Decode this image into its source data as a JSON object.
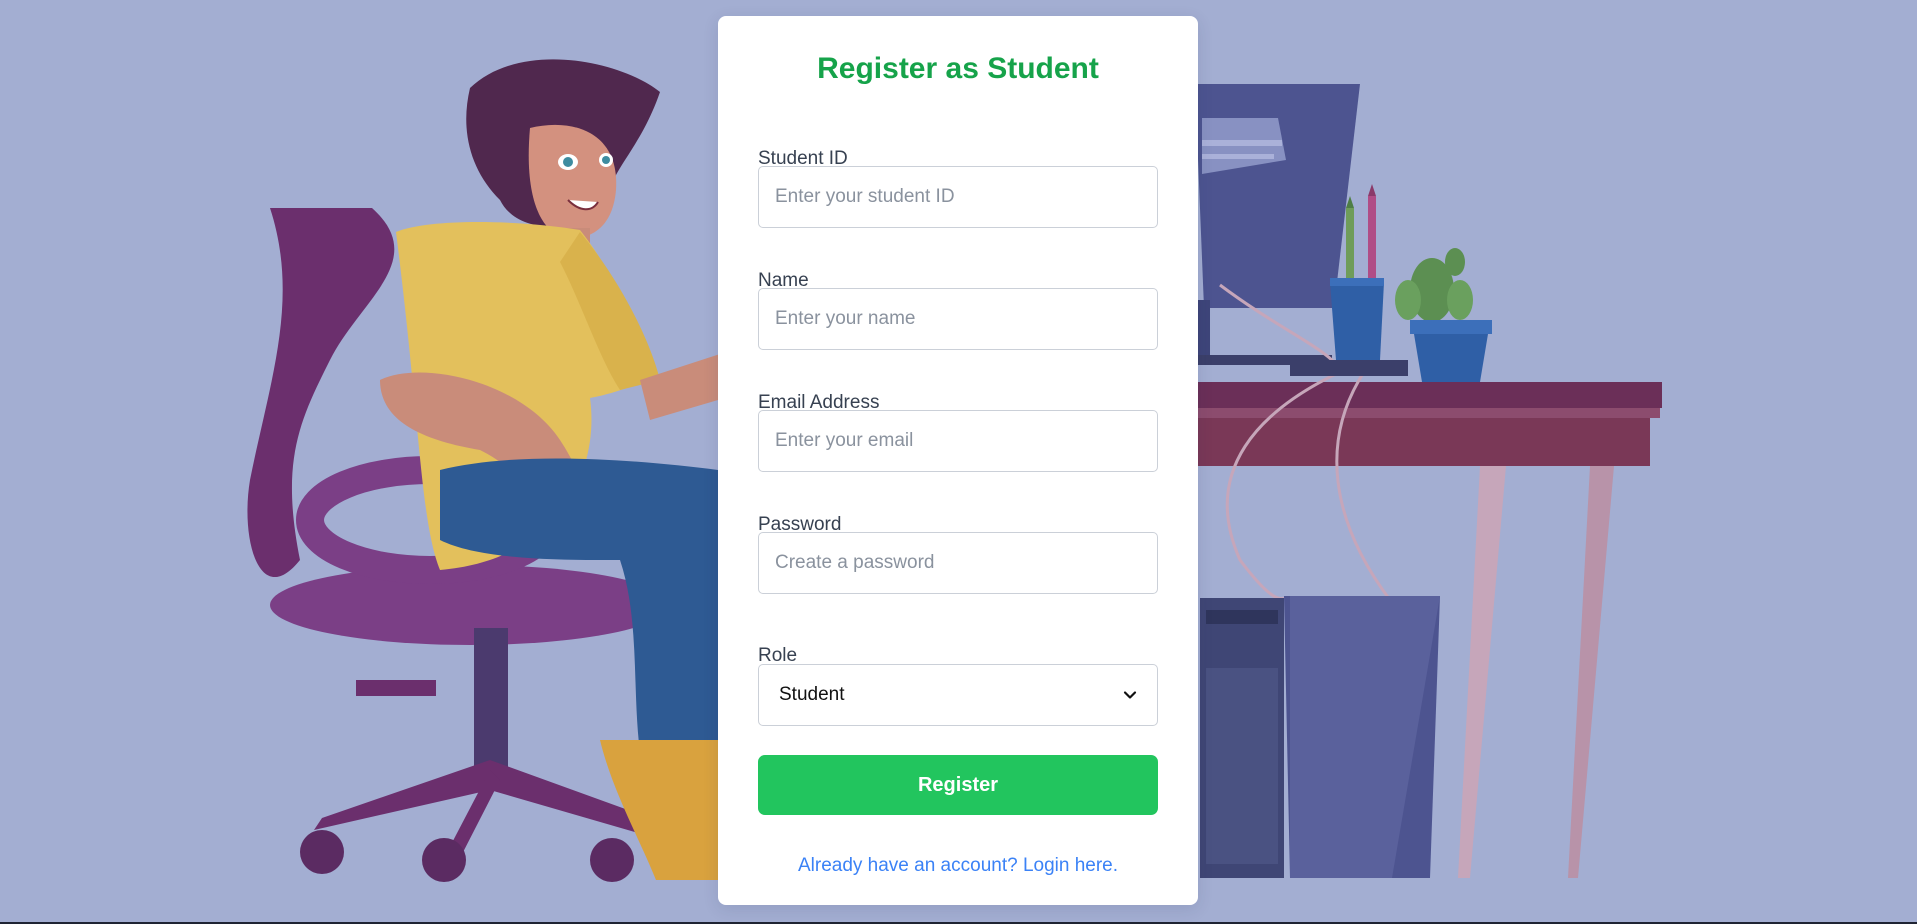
{
  "page": {
    "title": "Register as Student"
  },
  "form": {
    "student_id": {
      "label": "Student ID",
      "placeholder": "Enter your student ID",
      "value": ""
    },
    "name": {
      "label": "Name",
      "placeholder": "Enter your name",
      "value": ""
    },
    "email": {
      "label": "Email Address",
      "placeholder": "Enter your email",
      "value": ""
    },
    "password": {
      "label": "Password",
      "placeholder": "Create a password",
      "value": ""
    },
    "role": {
      "label": "Role",
      "selected": "Student"
    },
    "submit_label": "Register",
    "login_link_text": "Already have an account? Login here."
  },
  "theme": {
    "background": "#a3aed2",
    "title_color": "#16a34a",
    "button_color": "#22c55e",
    "link_color": "#3b82f6"
  },
  "icons": {
    "select_chevron": "chevron-down-icon"
  }
}
